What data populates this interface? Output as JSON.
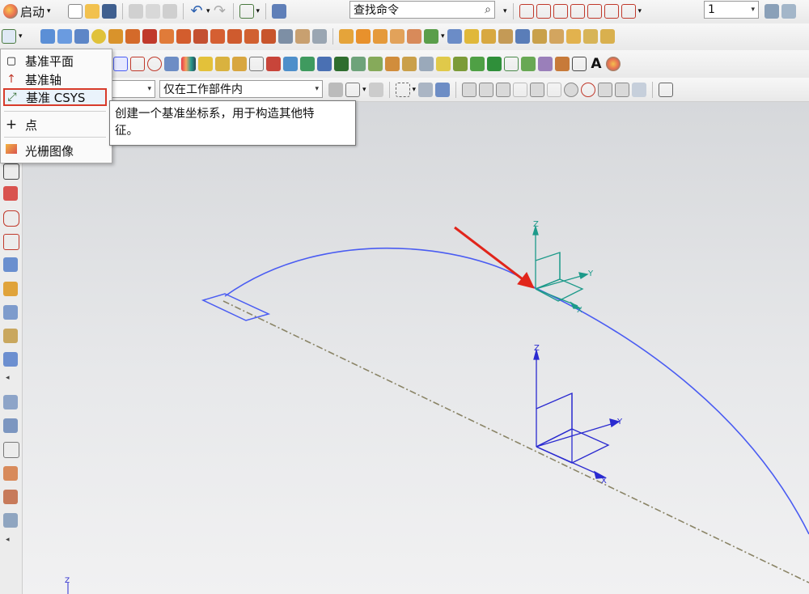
{
  "toolbar_top": {
    "start_label": "启动",
    "search_placeholder": "查找命令",
    "layer_value": "1"
  },
  "selection_bar": {
    "filter_value": "",
    "scope_value": "仅在工作部件内"
  },
  "datum_menu": {
    "items": [
      {
        "label": "基准平面",
        "icon": "datum-plane-icon"
      },
      {
        "label": "基准轴",
        "icon": "datum-axis-icon"
      },
      {
        "label": "基准 CSYS",
        "icon": "datum-csys-icon",
        "selected": true
      },
      {
        "label": "点",
        "icon": "point-icon"
      },
      {
        "label": "光栅图像",
        "icon": "raster-image-icon"
      }
    ]
  },
  "tooltip": {
    "line1": "创建一个基准坐标系，用于构造其他特",
    "line2": "征。"
  },
  "viewport": {
    "csys_upper": {
      "x_label": "X",
      "y_label": "Y",
      "z_label": "Z"
    },
    "csys_lower": {
      "x_label": "X",
      "y_label": "Y",
      "z_label": "Z"
    },
    "corner_label": "Z"
  },
  "colors": {
    "curve": "#4a5cf2",
    "csys_green": "#1d9a8a",
    "csys_blue": "#2a2ad0",
    "arrow_red": "#e1251b",
    "dashed_line": "#8a8466",
    "menu_highlight": "#d83b2b"
  }
}
